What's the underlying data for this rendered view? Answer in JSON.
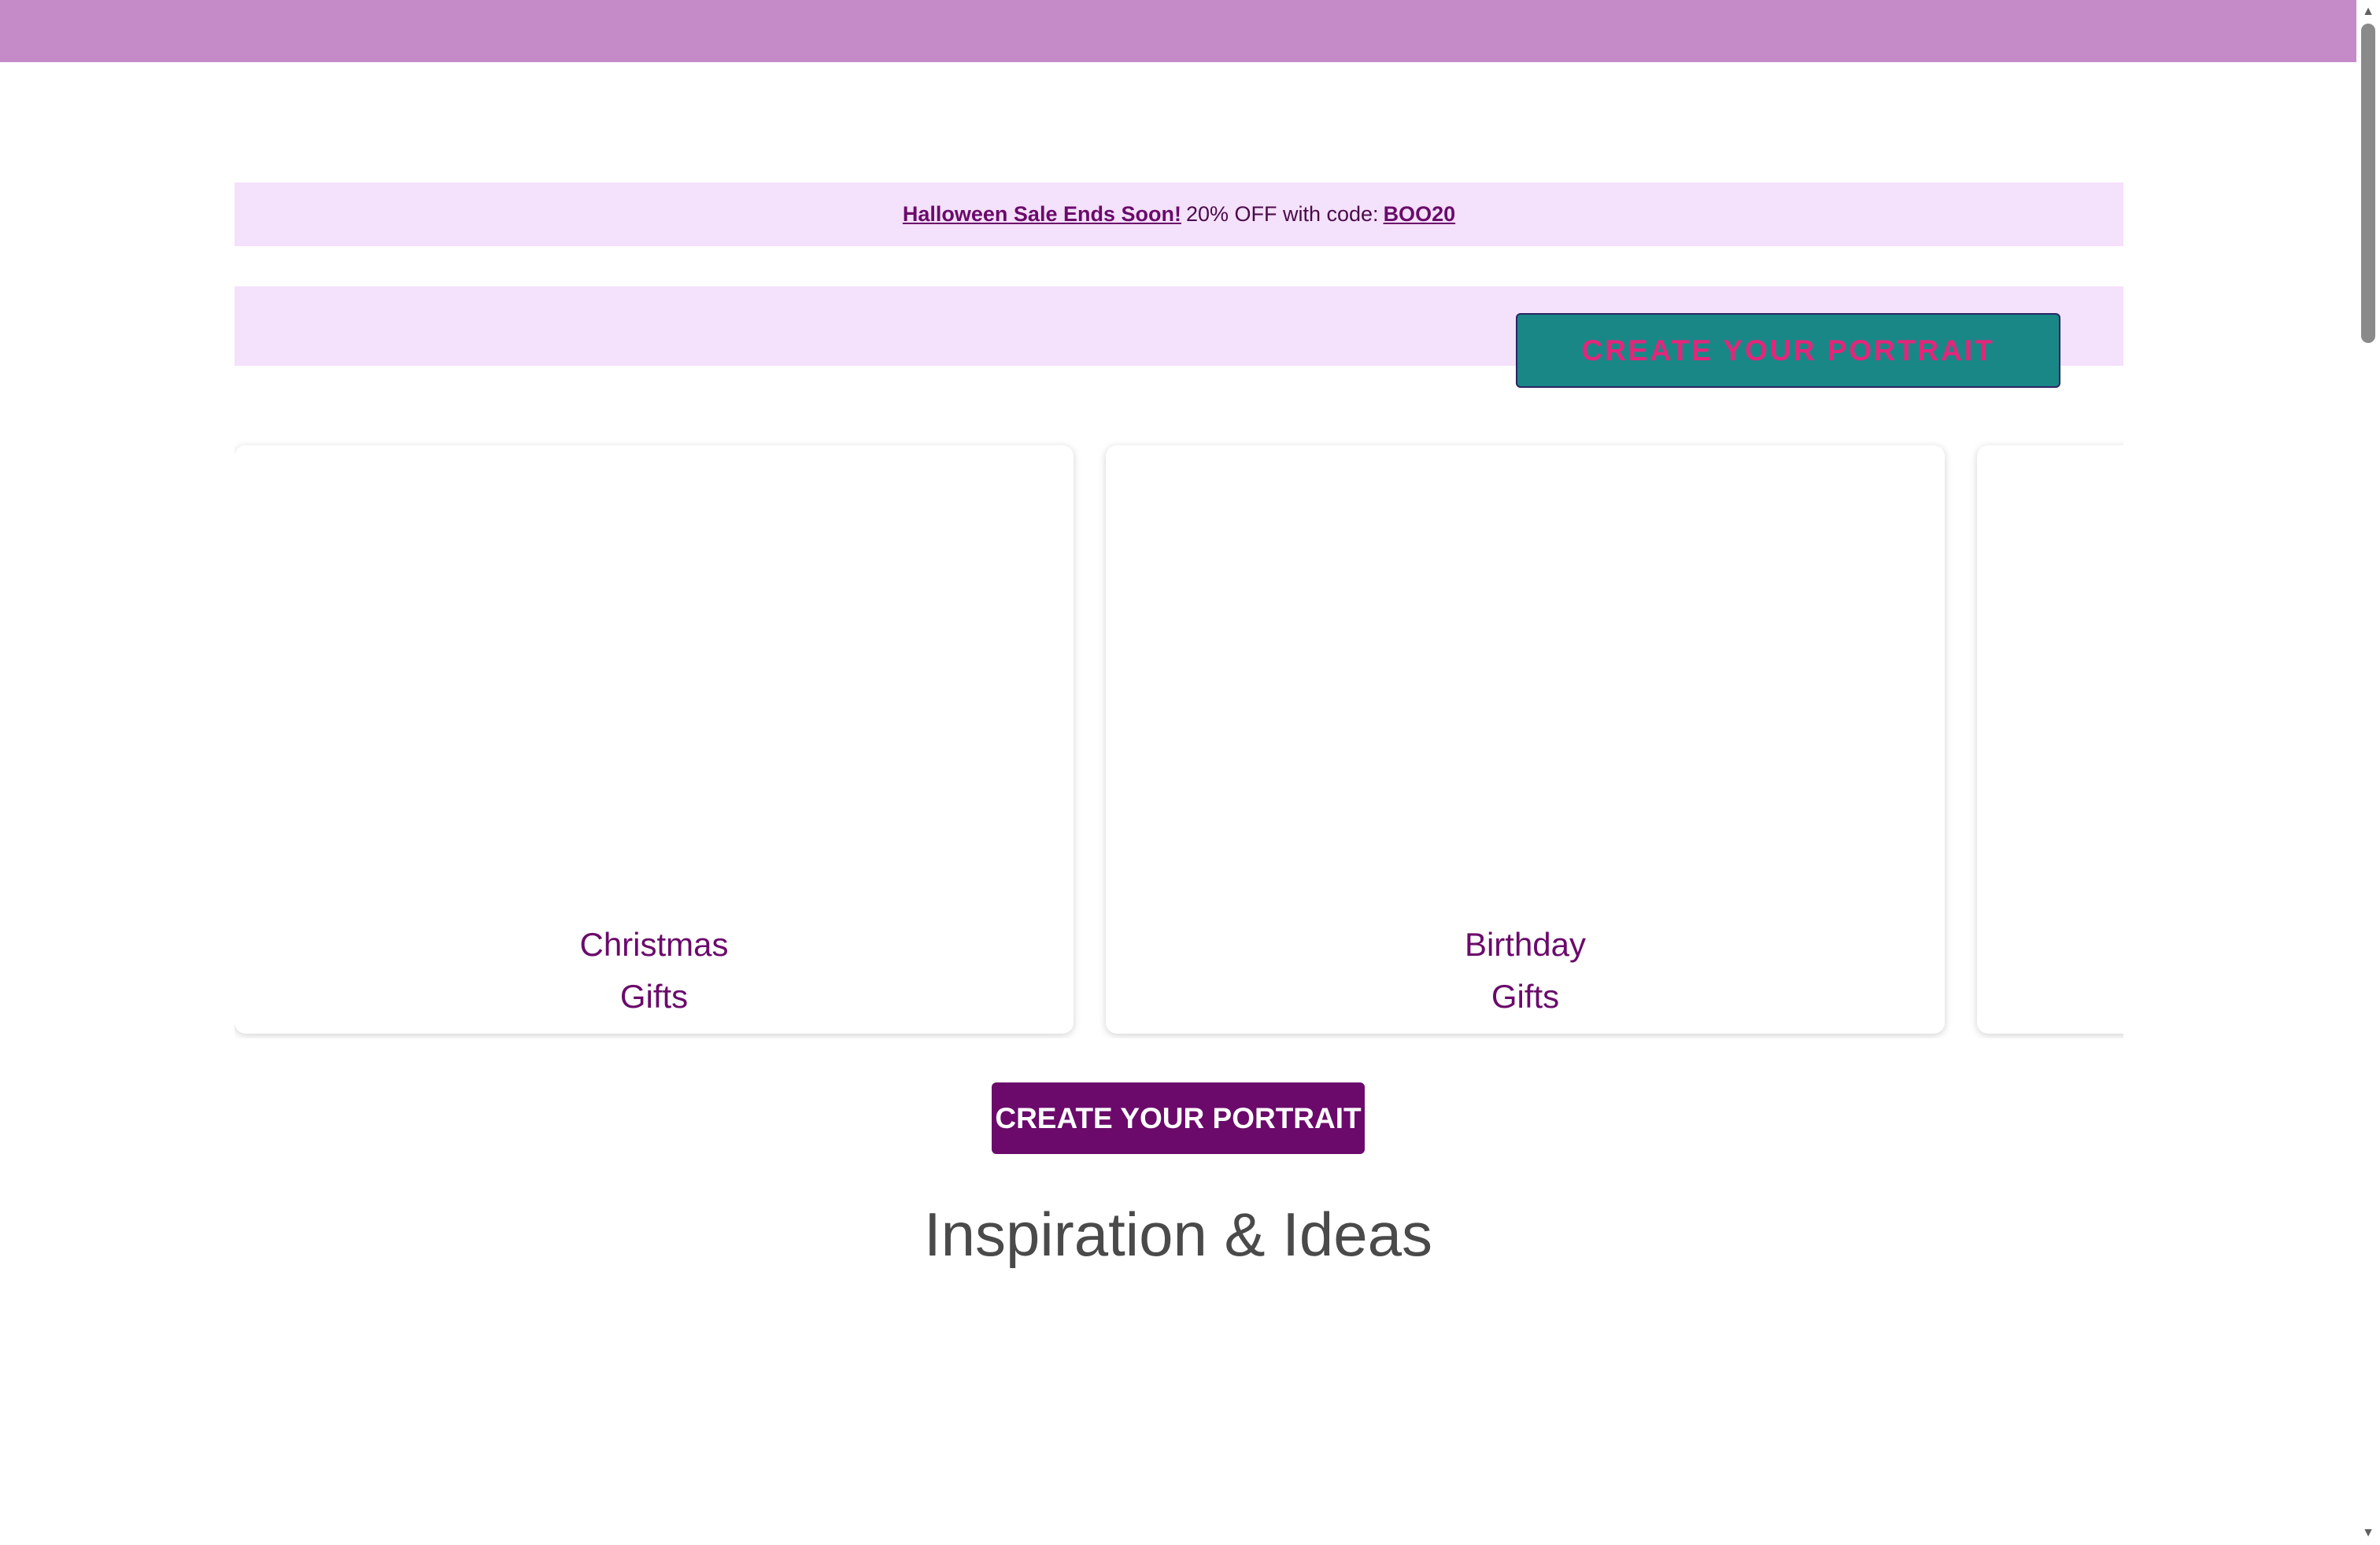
{
  "promo": {
    "sale_text": "Halloween Sale Ends Soon!",
    "offer_text": "20% OFF with code:",
    "code": "BOO20"
  },
  "header_cta": {
    "label": "CREATE YOUR PORTRAIT"
  },
  "categories": [
    {
      "line1": "Christmas",
      "line2": "Gifts"
    },
    {
      "line1": "Birthday",
      "line2": "Gifts"
    }
  ],
  "main_cta": {
    "label": "CREATE YOUR PORTRAIT"
  },
  "section": {
    "title": "Inspiration & Ideas"
  },
  "colors": {
    "topbar": "#c48bc8",
    "promo_bg": "#f4e1fb",
    "brand_purple": "#6b0a6b",
    "teal": "#1a8787",
    "pink": "#e5257a"
  },
  "scrollbar": {
    "up_icon": "▲",
    "down_icon": "▼"
  }
}
